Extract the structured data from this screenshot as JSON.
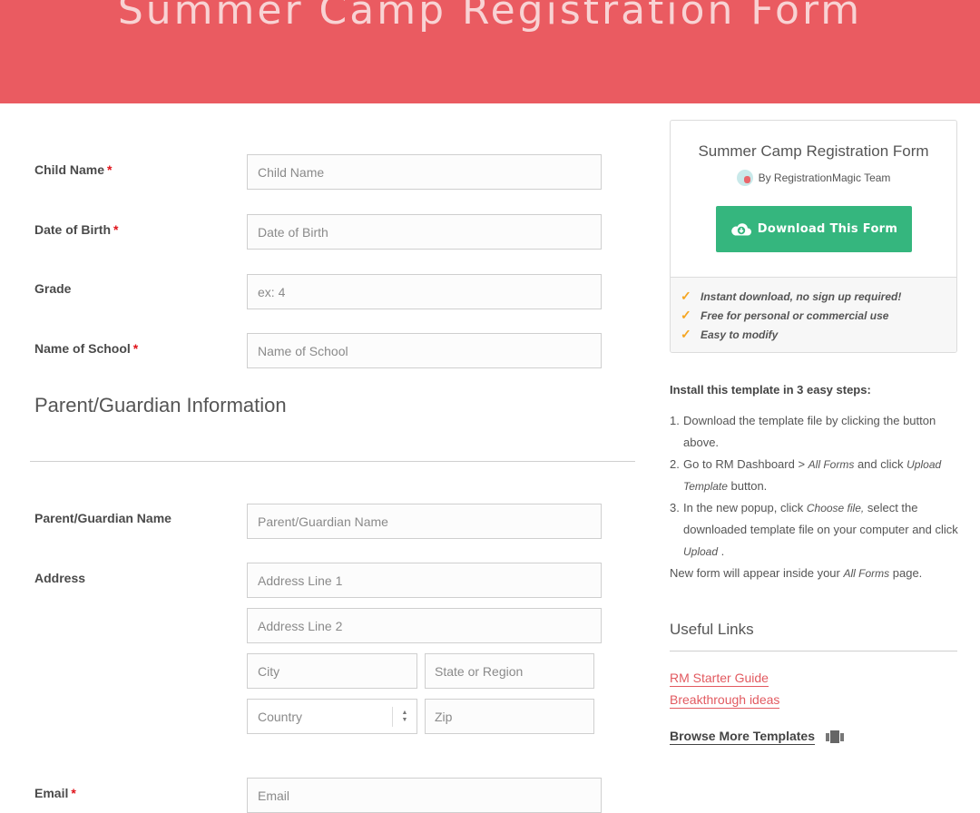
{
  "header": {
    "title": "Summer Camp Registration Form"
  },
  "form": {
    "fields": [
      {
        "label": "Child Name",
        "required": "*",
        "placeholder": "Child Name"
      },
      {
        "label": "Date of Birth",
        "required": "*",
        "placeholder": "Date of Birth"
      },
      {
        "label": "Grade",
        "required": "",
        "placeholder": "ex: 4"
      },
      {
        "label": "Name of School",
        "required": "*",
        "placeholder": "Name of School"
      }
    ],
    "section_title": "Parent/Guardian Information",
    "parent_name": {
      "label": "Parent/Guardian Name",
      "placeholder": "Parent/Guardian Name"
    },
    "address": {
      "label": "Address",
      "line1": "Address Line 1",
      "line2": "Address Line 2",
      "city": "City",
      "state": "State or Region",
      "country": "Country",
      "zip": "Zip"
    },
    "email": {
      "label": "Email",
      "required": "*",
      "placeholder": "Email"
    }
  },
  "sidebar": {
    "card": {
      "title": "Summer Camp Registration Form",
      "author": "By RegistrationMagic Team",
      "download_label": "Download This Form",
      "features": [
        "Instant download, no sign up required!",
        "Free for personal or commercial use",
        "Easy to modify"
      ]
    },
    "steps_title": "Install this template in 3 easy steps:",
    "steps": {
      "s1_num": "1.",
      "s1_text": "Download the template file by clicking the button above.",
      "s2_num": "2.",
      "s2_a": "Go to RM Dashboard > ",
      "s2_b": "All Forms",
      "s2_c": " and click ",
      "s2_d": "Upload Template",
      "s2_e": " button.",
      "s3_num": "3.",
      "s3_a": "In the new popup, click ",
      "s3_b": "Choose file,",
      "s3_c": " select the downloaded template file on your computer and click ",
      "s3_d": "Upload",
      "s3_e": " .",
      "final_a": "New form will appear inside your ",
      "final_b": "All Forms",
      "final_c": " page."
    },
    "links_title": "Useful Links",
    "links": [
      "RM Starter Guide",
      "Breakthrough ideas"
    ],
    "browse_label": "Browse More Templates"
  },
  "colors": {
    "brand": "#ea5b61",
    "download": "#35b67e",
    "check": "#f5a623",
    "link": "#e25a60",
    "required": "#e0131a"
  }
}
